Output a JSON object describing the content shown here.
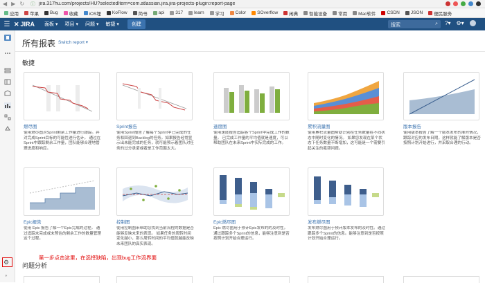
{
  "browser": {
    "url": "jira.317hu.com/projects/HU?selectedItem=com.atlassian.jira.jira-projects-plugin:report-page",
    "bookmarks": [
      "应用",
      "苹果",
      "Bug",
      "收藏",
      "iOS埋",
      "KoFlow",
      "简书",
      "api",
      "317",
      "learn",
      "学习",
      "Color",
      "SOverflow",
      "闲典",
      "智能设备",
      "常用",
      "Mac软件",
      "CSDN",
      "JSON",
      "便民服务"
    ]
  },
  "topnav": {
    "logo": "JIRA",
    "items": [
      "面板 ▾",
      "项目 ▾",
      "问题 ▾",
      "敏捷 ▾"
    ],
    "create": "创建",
    "search_placeholder": "搜索"
  },
  "page": {
    "title": "所有报表",
    "switch": "Switch report ▾"
  },
  "sections": {
    "agile": "敏捷",
    "issue_analysis": "问题分析"
  },
  "reports": [
    {
      "title": "燃尽图",
      "desc": "使用燃尽图对Sprint剩余工作量进行跟踪。并对完成Sprint目标的可能性进行估计。 通过在Sprint中跟踪剩余工作量，团队能够合理地管理进度和响应。"
    },
    {
      "title": "Sprint报告",
      "desc": "使用Sprint报告了解每个Sprint中已完成的任务和回退到Backlog的任务。如果报告经常显示出未能完成的任务，就可能预示着团队对任务的过分承诺或者是工作范围太大。"
    },
    {
      "title": "速度图",
      "desc": "使用速度报告追踪各个Sprint中完成工作的数量。 已完成工作量的平均值就是速度，可以帮助团队在未来Sprint中实际完成的工作。"
    },
    {
      "title": "累积流量图",
      "desc": "使用累积流量图帮助识别在任务数量在不同状态中随时变化的情况。 如果您发现在某个状态下任务数量不断增加，这可能是一个需要引起关注的瓶颈问题。"
    },
    {
      "title": "版本报告",
      "desc": "使用版本报告了解一个版本发布的准时情况，跟踪对应的发布日期，这样就能了解版本是否按照计划开始进行，并采取合理的行动。"
    },
    {
      "title": "Epic报告",
      "desc": "使用 Epic 报告了解一个Epic完成的过程。 通过追踪未完成或未预估的剩余工作的数量管理这个过程。"
    },
    {
      "title": "控制图",
      "desc": "使用控制图来帮助您找到当前流程的数据是否能够反映未来的表现。 如果任务的周转时间变化越小，那么周转时间的平均值就越能反映未来团队的真实表现。"
    },
    {
      "title": "Epic燃尽图",
      "desc": "Epic 燃尽图用于预计Epic发布的的及时性。通过跟踪多个Sprint的信息，能够注意到是否按照计划开始合理运行。"
    },
    {
      "title": "发布燃尽图",
      "desc": "发布燃尽图用于预计版本发布的及时性。通过跟踪多个Sprint的信息。能够注意到是否按照计划开始合理运行。"
    }
  ],
  "annotation": "第一步点击这里，在选择缺陷，出现bug工作流界面",
  "colors": {
    "jira_blue": "#205081",
    "link": "#3b73af",
    "annotation_red": "#e00000"
  }
}
